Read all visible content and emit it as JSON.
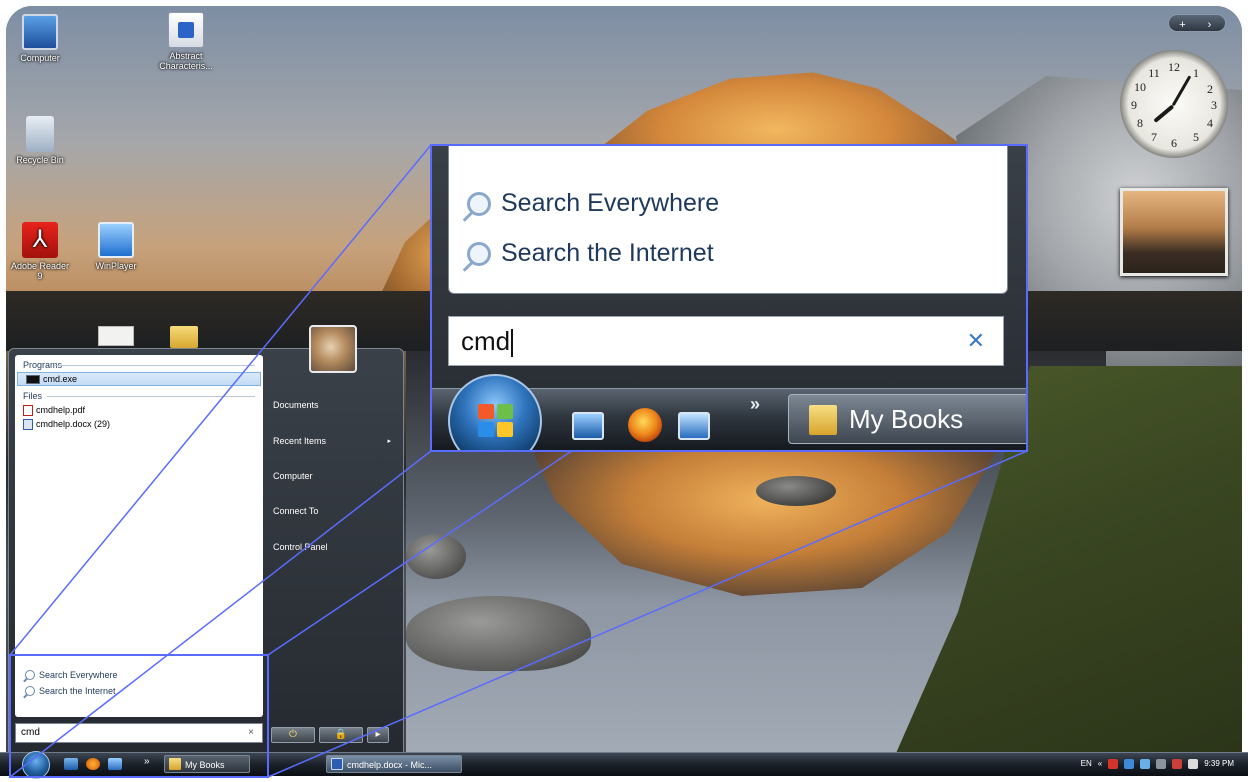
{
  "desktop": {
    "icons": [
      {
        "label": "Computer",
        "icon": "computer-icon"
      },
      {
        "label": "Abstract Characteris...",
        "icon": "document-icon"
      },
      {
        "label": "Recycle Bin",
        "icon": "recycle-bin-icon"
      },
      {
        "label": "Adobe Reader 9",
        "icon": "adobe-reader-icon"
      },
      {
        "label": "WinPlayer",
        "icon": "media-player-icon"
      }
    ]
  },
  "gadgets": {
    "toolbar": {
      "add": "+",
      "next": "›"
    },
    "clock_numbers": [
      "12",
      "1",
      "2",
      "3",
      "4",
      "5",
      "6",
      "7",
      "8",
      "9",
      "10",
      "11"
    ]
  },
  "start_menu": {
    "programs_heading": "Programs",
    "programs": [
      {
        "label": "cmd.exe",
        "icon": "cmd-icon"
      }
    ],
    "files_heading": "Files",
    "files": [
      {
        "label": "cmdhelp.pdf",
        "icon": "pdf-icon"
      },
      {
        "label": "cmdhelp.docx (29)",
        "icon": "docx-icon"
      }
    ],
    "search_everywhere": "Search Everywhere",
    "search_internet": "Search the Internet",
    "search_value": "cmd",
    "clear_glyph": "×",
    "right_links": {
      "documents": "Documents",
      "recent_items": "Recent Items",
      "computer": "Computer",
      "connect_to": "Connect To",
      "control_panel": "Control Panel"
    },
    "submenu_arrow": "▸",
    "power_glyph": "⏻",
    "lock_glyph": "🔒",
    "more_glyph": "▸"
  },
  "taskbar": {
    "quicklaunch_more": "»",
    "buttons": [
      {
        "label": "My Books",
        "icon": "folder-icon"
      },
      {
        "label": "cmdhelp.docx - Mic...",
        "icon": "word-icon"
      }
    ],
    "tray": {
      "language": "EN",
      "expand": "«",
      "time": "9:39 PM"
    }
  },
  "zoom_inset": {
    "search_everywhere": "Search Everywhere",
    "search_internet": "Search the Internet",
    "search_value": "cmd",
    "clear_glyph": "✕",
    "chevron": "»",
    "taskbar_button": "My Books"
  },
  "colors": {
    "zoom_outline": "#5a6cff",
    "link_text": "#1e395b",
    "taskbar_dark": "#1b2129"
  }
}
